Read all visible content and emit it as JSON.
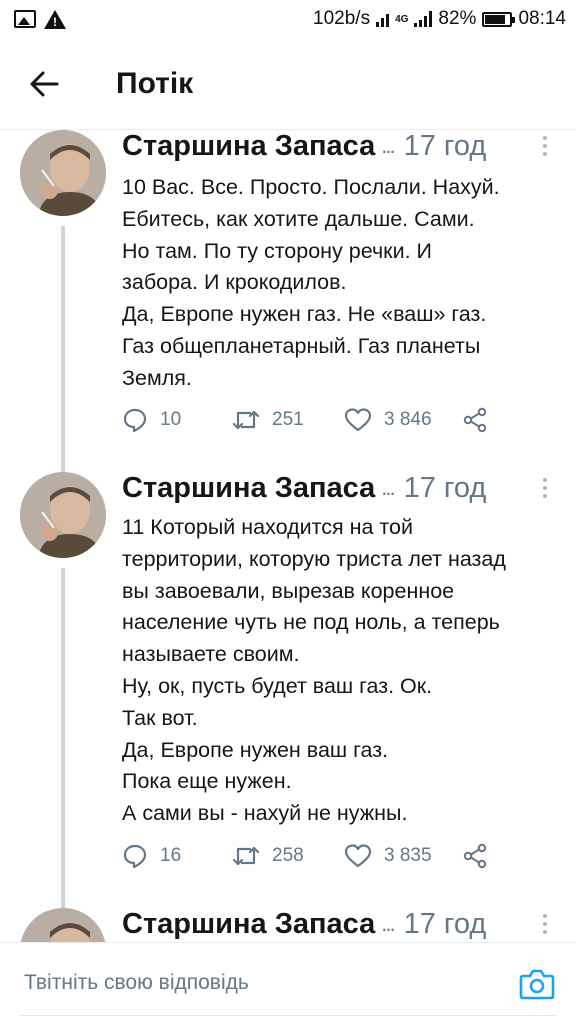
{
  "status_bar": {
    "network_speed": "102b/s",
    "network_type": "4G",
    "battery": "82%",
    "battery_level": 0.82,
    "time": "08:14",
    "icons": [
      "image-notification-icon",
      "warning-icon",
      "signal-icon",
      "battery-icon"
    ]
  },
  "header": {
    "back_icon": "arrow-left-icon",
    "title": "Потік"
  },
  "colors": {
    "text": "#14171a",
    "secondary": "#657786",
    "accent": "#1da1f2",
    "divider": "#e6ecf0",
    "thread_line": "#ccd6dd"
  },
  "tweets": [
    {
      "author": "Старшина Запаса",
      "handle_ellipsis": "...",
      "time": "17 год",
      "lines": [
        "10 Вас. Все. Просто. Послали. Нахуй.",
        "Ебитесь, как хотите дальше. Сами.",
        "Но там. По ту сторону речки. И",
        "забора. И крокодилов.",
        "Да, Европе нужен газ. Не «ваш» газ.",
        "Газ общепланетарный. Газ планеты",
        "Земля."
      ],
      "replies": "10",
      "retweets": "251",
      "likes": "3 846"
    },
    {
      "author": "Старшина Запаса",
      "handle_ellipsis": "...",
      "time": "17 год",
      "lines": [
        "11 Который находится на той",
        "территории, которую триста лет назад",
        "вы завоевали, вырезав коренное",
        "население чуть не под ноль, а теперь",
        "называете своим.",
        "Ну, ок, пусть будет ваш газ. Ок.",
        "Так вот.",
        "Да, Европе нужен ваш газ.",
        "Пока еще нужен.",
        "А сами вы - нахуй не нужны."
      ],
      "replies": "16",
      "retweets": "258",
      "likes": "3 835"
    },
    {
      "author": "Старшина Запаса",
      "handle_ellipsis": "...",
      "time": "17 год"
    }
  ],
  "reply_bar": {
    "placeholder": "Твітніть свою відповідь",
    "camera_icon": "camera-icon"
  }
}
